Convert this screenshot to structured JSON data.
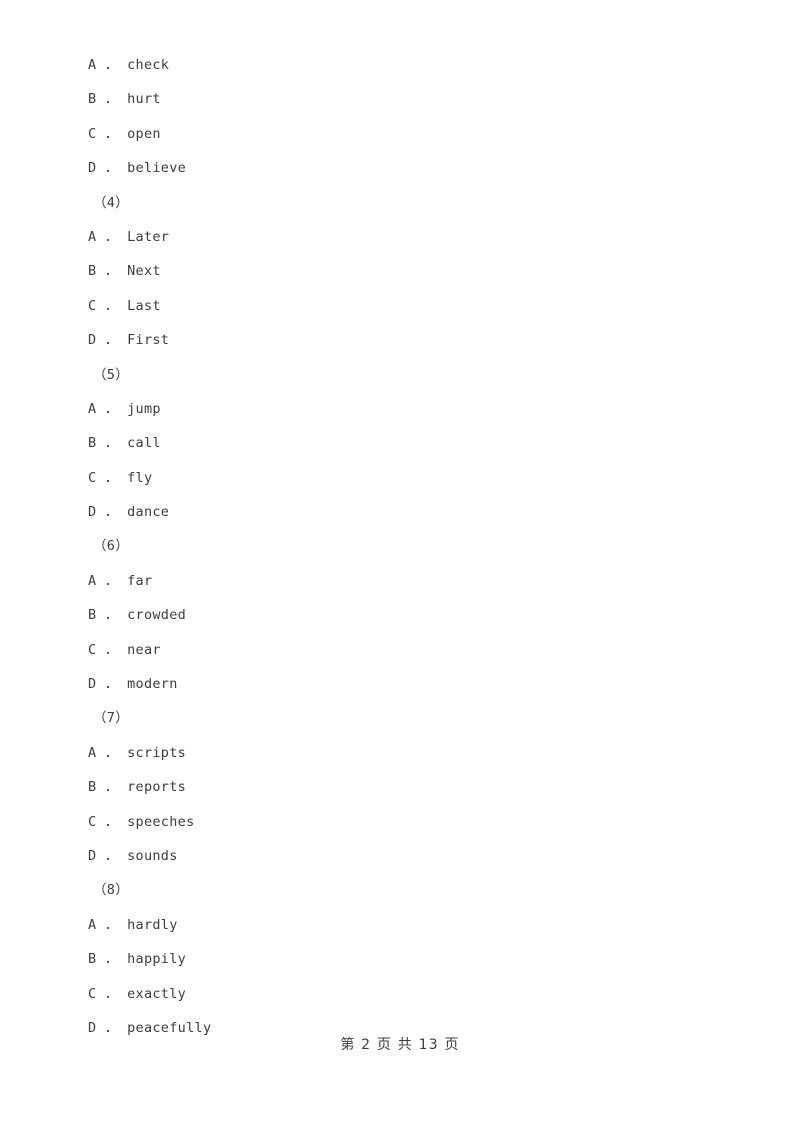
{
  "document": {
    "page_footer": "第 2 页 共 13 页",
    "option_separator": " ． "
  },
  "blocks": [
    {
      "number_label": "",
      "options": [
        {
          "letter": "A",
          "text": "check"
        },
        {
          "letter": "B",
          "text": "hurt"
        },
        {
          "letter": "C",
          "text": "open"
        },
        {
          "letter": "D",
          "text": "believe"
        }
      ]
    },
    {
      "number_label": "（4）",
      "options": [
        {
          "letter": "A",
          "text": "Later"
        },
        {
          "letter": "B",
          "text": "Next"
        },
        {
          "letter": "C",
          "text": "Last"
        },
        {
          "letter": "D",
          "text": "First"
        }
      ]
    },
    {
      "number_label": "（5）",
      "options": [
        {
          "letter": "A",
          "text": "jump"
        },
        {
          "letter": "B",
          "text": "call"
        },
        {
          "letter": "C",
          "text": "fly"
        },
        {
          "letter": "D",
          "text": "dance"
        }
      ]
    },
    {
      "number_label": "（6）",
      "options": [
        {
          "letter": "A",
          "text": "far"
        },
        {
          "letter": "B",
          "text": "crowded"
        },
        {
          "letter": "C",
          "text": "near"
        },
        {
          "letter": "D",
          "text": "modern"
        }
      ]
    },
    {
      "number_label": "（7）",
      "options": [
        {
          "letter": "A",
          "text": "scripts"
        },
        {
          "letter": "B",
          "text": "reports"
        },
        {
          "letter": "C",
          "text": "speeches"
        },
        {
          "letter": "D",
          "text": "sounds"
        }
      ]
    },
    {
      "number_label": "（8）",
      "options": [
        {
          "letter": "A",
          "text": "hardly"
        },
        {
          "letter": "B",
          "text": "happily"
        },
        {
          "letter": "C",
          "text": "exactly"
        },
        {
          "letter": "D",
          "text": "peacefully"
        }
      ]
    }
  ]
}
